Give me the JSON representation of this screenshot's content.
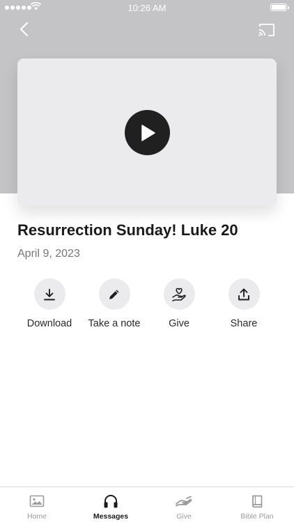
{
  "status_bar": {
    "time": "10:26 AM"
  },
  "message": {
    "title": "Resurrection Sunday! Luke 20",
    "date": "April 9, 2023"
  },
  "actions": [
    {
      "label": "Download",
      "icon": "download-icon"
    },
    {
      "label": "Take a note",
      "icon": "pencil-icon"
    },
    {
      "label": "Give",
      "icon": "heart-hand-icon"
    },
    {
      "label": "Share",
      "icon": "share-icon"
    }
  ],
  "tabs": [
    {
      "label": "Home",
      "icon": "image-icon",
      "active": false
    },
    {
      "label": "Messages",
      "icon": "headphones-icon",
      "active": true
    },
    {
      "label": "Give",
      "icon": "giving-hand-icon",
      "active": false
    },
    {
      "label": "Bible Plan",
      "icon": "book-icon",
      "active": false
    }
  ],
  "colors": {
    "hero_background": "#c4c4c6",
    "video_placeholder": "#ebebed",
    "play_button": "#202020",
    "active_tab": "#1a1a1a",
    "inactive_tab": "#9a9a9a"
  }
}
